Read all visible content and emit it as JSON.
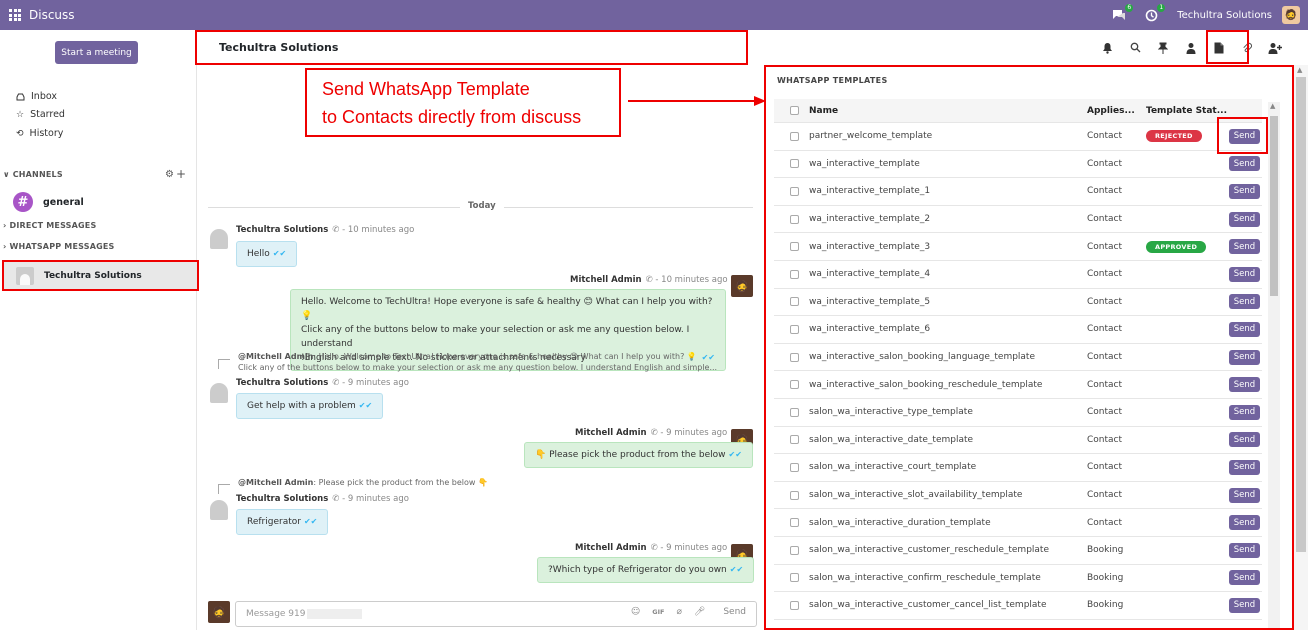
{
  "topbar": {
    "app_title": "Discuss",
    "chat_badge": "6",
    "activity_badge": "1",
    "company": "Techultra Solutions"
  },
  "sidebar": {
    "start_meeting": "Start a meeting",
    "inbox": "Inbox",
    "starred": "Starred",
    "history": "History",
    "channels_label": "CHANNELS",
    "channel_general": "general",
    "direct_label": "DIRECT MESSAGES",
    "whatsapp_label": "WHATSAPP MESSAGES",
    "active_chat": "Techultra Solutions"
  },
  "chat": {
    "title": "Techultra Solutions",
    "today": "Today",
    "composer_placeholder": "Message 919",
    "send_label": "Send",
    "messages": [
      {
        "author": "Techultra Solutions",
        "time": "- 10 minutes ago",
        "text": "Hello"
      },
      {
        "author": "Mitchell Admin",
        "time": "- 10 minutes ago",
        "line1": "Hello. Welcome to TechUltra! Hope everyone is safe & healthy 😊 What can I help you with? 💡",
        "line2": "Click any of the buttons below to make your selection or ask me any question below. I understand",
        "line3": "!English and simple text. No stickers or attachments necessary"
      },
      {
        "quote_author": "@Mitchell Admin",
        "quote1": "Hello. Welcome to TechUltra! Hope everyone is safe & healthy 😊 What can I help you with? 💡",
        "quote2": "Click any of the buttons below to make your selection or ask me any question below. I understand English and simple...",
        "author": "Techultra Solutions",
        "time": "- 9 minutes ago",
        "text": "Get help with a problem"
      },
      {
        "author": "Mitchell Admin",
        "time": "- 9 minutes ago",
        "text": "👇 Please pick the product from the below"
      },
      {
        "quote_author": "@Mitchell Admin",
        "quote1": "Please pick the product from the below 👇",
        "author": "Techultra Solutions",
        "time": "- 9 minutes ago",
        "text": "Refrigerator"
      },
      {
        "author": "Mitchell Admin",
        "time": "- 9 minutes ago",
        "text": "?Which type of Refrigerator do you own"
      }
    ]
  },
  "annotation": {
    "line1": "Send WhatsApp Template",
    "line2": "to Contacts directly from discuss"
  },
  "wa_panel": {
    "title": "WHATSAPP TEMPLATES",
    "col_name": "Name",
    "col_applies": "Applies...",
    "col_status": "Template Stat...",
    "send_label": "Send",
    "rows": [
      {
        "name": "partner_welcome_template",
        "applies": "Contact",
        "status": "REJECTED"
      },
      {
        "name": "wa_interactive_template",
        "applies": "Contact",
        "status": ""
      },
      {
        "name": "wa_interactive_template_1",
        "applies": "Contact",
        "status": ""
      },
      {
        "name": "wa_interactive_template_2",
        "applies": "Contact",
        "status": ""
      },
      {
        "name": "wa_interactive_template_3",
        "applies": "Contact",
        "status": "APPROVED"
      },
      {
        "name": "wa_interactive_template_4",
        "applies": "Contact",
        "status": ""
      },
      {
        "name": "wa_interactive_template_5",
        "applies": "Contact",
        "status": ""
      },
      {
        "name": "wa_interactive_template_6",
        "applies": "Contact",
        "status": ""
      },
      {
        "name": "wa_interactive_salon_booking_language_template",
        "applies": "Contact",
        "status": ""
      },
      {
        "name": "wa_interactive_salon_booking_reschedule_template",
        "applies": "Contact",
        "status": ""
      },
      {
        "name": "salon_wa_interactive_type_template",
        "applies": "Contact",
        "status": ""
      },
      {
        "name": "salon_wa_interactive_date_template",
        "applies": "Contact",
        "status": ""
      },
      {
        "name": "salon_wa_interactive_court_template",
        "applies": "Contact",
        "status": ""
      },
      {
        "name": "salon_wa_interactive_slot_availability_template",
        "applies": "Contact",
        "status": ""
      },
      {
        "name": "salon_wa_interactive_duration_template",
        "applies": "Contact",
        "status": ""
      },
      {
        "name": "salon_wa_interactive_customer_reschedule_template",
        "applies": "Booking",
        "status": ""
      },
      {
        "name": "salon_wa_interactive_confirm_reschedule_template",
        "applies": "Booking",
        "status": ""
      },
      {
        "name": "salon_wa_interactive_customer_cancel_list_template",
        "applies": "Booking",
        "status": ""
      }
    ]
  },
  "colors": {
    "brand": "#71639e",
    "highlight": "#ee0000",
    "rejected": "#dc3545",
    "approved": "#28a745"
  }
}
